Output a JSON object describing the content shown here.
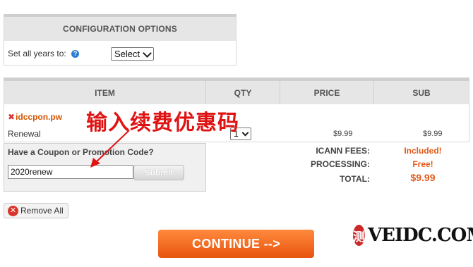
{
  "config": {
    "header": "CONFIGURATION OPTIONS",
    "label": "Set all years to:",
    "help_icon": "?",
    "select_value": "Select"
  },
  "table": {
    "headers": [
      "ITEM",
      "QTY",
      "PRICE",
      "SUB"
    ],
    "item": {
      "remove_icon": "✖",
      "domain": "idccpon.pw",
      "type": "Renewal",
      "qty": "1",
      "price": "$9.99",
      "sub": "$9.99"
    }
  },
  "coupon": {
    "label": "Have a Coupon or Promotion Code?",
    "value": "2020renew",
    "submit": "Submit"
  },
  "totals": [
    {
      "label": "ICANN FEES:",
      "value": "Included!"
    },
    {
      "label": "PROCESSING:",
      "value": "Free!"
    },
    {
      "label": "TOTAL:",
      "value": "$9.99"
    }
  ],
  "remove_all": "Remove All",
  "continue": "CONTINUE -->",
  "annotation": "输入续费优惠码",
  "watermark": {
    "logo": "测",
    "text": "VEIDC.COM"
  }
}
